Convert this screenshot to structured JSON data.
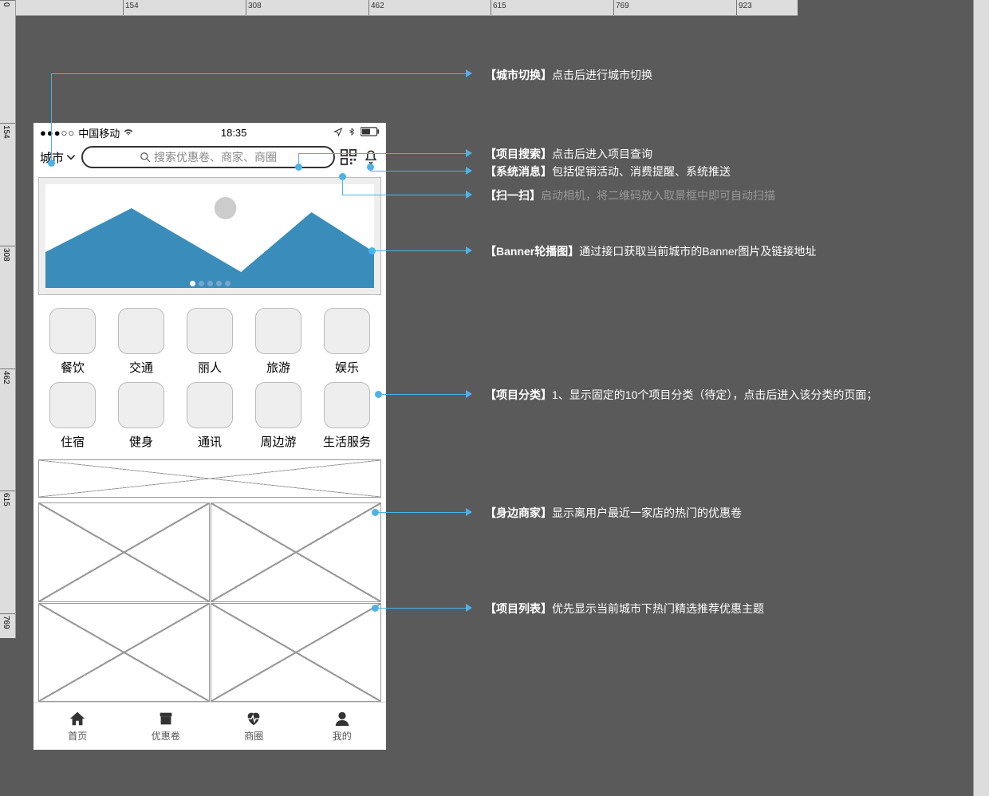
{
  "ruler": {
    "h_marks": [
      "0",
      "154",
      "308",
      "462",
      "615",
      "769",
      "923"
    ],
    "v_marks": [
      "0",
      "154",
      "308",
      "462",
      "615",
      "769"
    ]
  },
  "status": {
    "dots": "●●●○○",
    "carrier": "中国移动",
    "time": "18:35",
    "bt_loc": "⇢ ⚡"
  },
  "search_row": {
    "city_label": "城市",
    "placeholder": "搜索优惠卷、商家、商圈"
  },
  "categories": [
    {
      "label": "餐饮"
    },
    {
      "label": "交通"
    },
    {
      "label": "丽人"
    },
    {
      "label": "旅游"
    },
    {
      "label": "娱乐"
    },
    {
      "label": "住宿"
    },
    {
      "label": "健身"
    },
    {
      "label": "通讯"
    },
    {
      "label": "周边游"
    },
    {
      "label": "生活服务"
    }
  ],
  "tabs": [
    {
      "label": "首页"
    },
    {
      "label": "优惠卷"
    },
    {
      "label": "商圈"
    },
    {
      "label": "我的"
    }
  ],
  "annotations": {
    "city": {
      "title": "【城市切换】",
      "desc": "点击后进行城市切换"
    },
    "search": {
      "title": "【项目搜索】",
      "desc": "点击后进入项目查询"
    },
    "message": {
      "title": "【系统消息】",
      "desc": "包括促销活动、消费提醒、系统推送"
    },
    "scan": {
      "title": "【扫一扫】",
      "desc": "启动相机，将二维码放入取景框中即可自动扫描"
    },
    "banner": {
      "title": "【Banner轮播图】",
      "desc": "通过接口获取当前城市的Banner图片及链接地址"
    },
    "cat": {
      "title": "【项目分类】",
      "desc": "1、显示固定的10个项目分类（待定），点击后进入该分类的页面；"
    },
    "nearby": {
      "title": "【身边商家】",
      "desc": "显示离用户最近一家店的热门的优惠卷"
    },
    "list": {
      "title": "【项目列表】",
      "desc": "优先显示当前城市下热门精选推荐优惠主题"
    }
  }
}
